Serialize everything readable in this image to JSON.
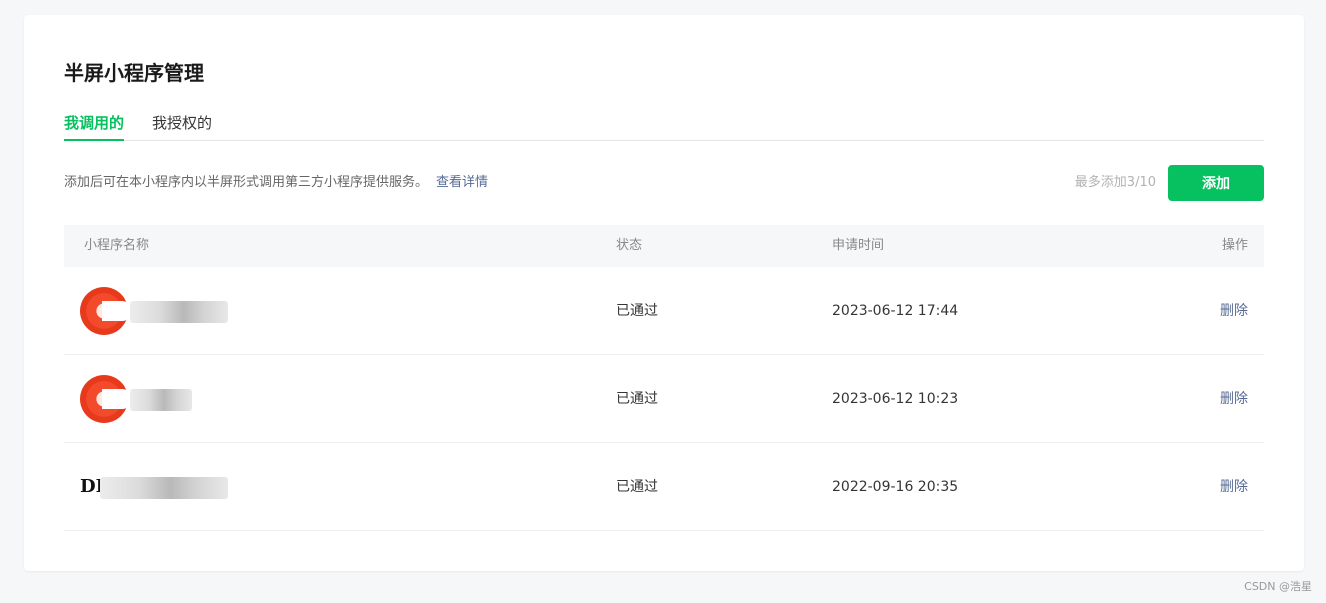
{
  "page": {
    "title": "半屏小程序管理"
  },
  "tabs": [
    {
      "label": "我调用的",
      "active": true
    },
    {
      "label": "我授权的",
      "active": false
    }
  ],
  "intro": {
    "text": "添加后可在本小程序内以半屏形式调用第三方小程序提供服务。",
    "link": "查看详情"
  },
  "limit": "最多添加3/10",
  "add_button": "添加",
  "table": {
    "headers": [
      "小程序名称",
      "状态",
      "申请时间",
      "操作"
    ],
    "rows": [
      {
        "status": "已通过",
        "time": "2023-06-12 17:44",
        "action": "删除"
      },
      {
        "status": "已通过",
        "time": "2023-06-12 10:23",
        "action": "删除"
      },
      {
        "logo_text": "DI",
        "status": "已通过",
        "time": "2022-09-16 20:35",
        "action": "删除"
      }
    ]
  },
  "footer": "CSDN @浩星",
  "colors": {
    "accent": "#07c160",
    "link": "#576b95"
  }
}
